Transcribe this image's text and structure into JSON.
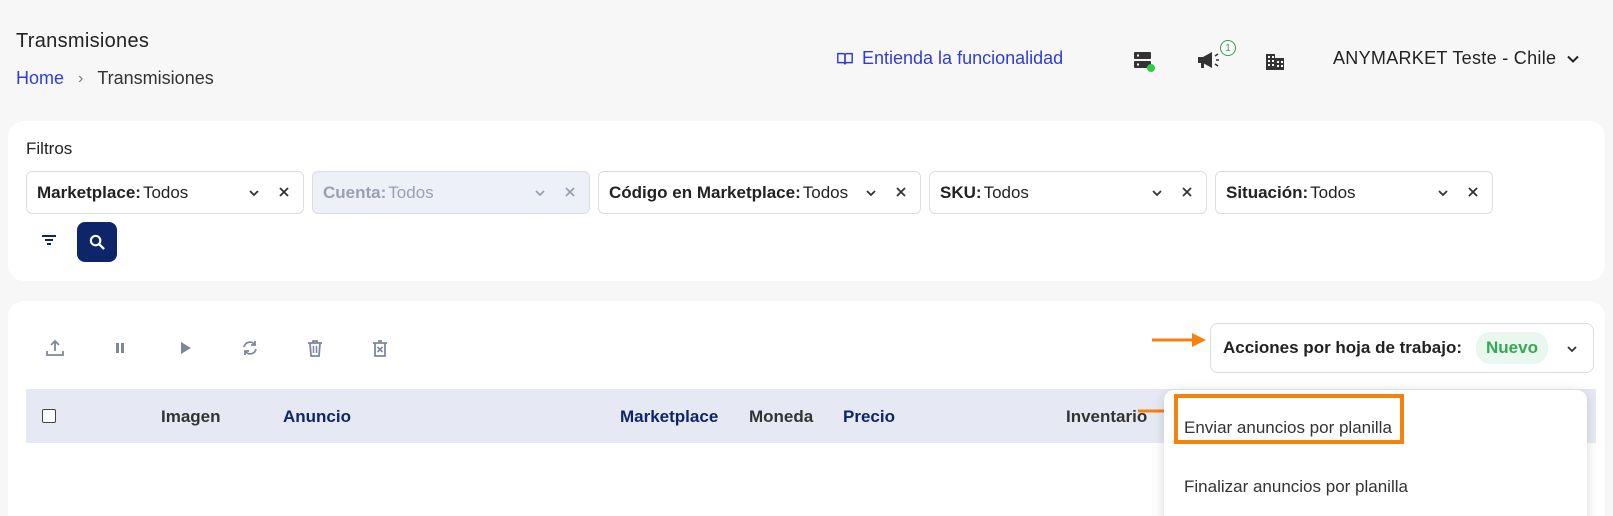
{
  "header": {
    "title": "Transmisiones",
    "breadcrumb": {
      "home": "Home",
      "current": "Transmisiones"
    },
    "learn_link": "Entienda la funcionalidad",
    "notification_count": "1",
    "account": "ANYMARKET Teste - Chile"
  },
  "filters": {
    "label": "Filtros",
    "items": [
      {
        "label": "Marketplace:",
        "value": "Todos"
      },
      {
        "label": "Cuenta:",
        "value": "Todos"
      },
      {
        "label": "Código en Marketplace:",
        "value": "Todos"
      },
      {
        "label": "SKU:",
        "value": "Todos"
      },
      {
        "label": "Situación:",
        "value": "Todos"
      }
    ]
  },
  "actions": {
    "label": "Acciones por hoja de trabajo:",
    "badge": "Nuevo",
    "menu": [
      "Enviar anuncios por planilla",
      "Finalizar anuncios por planilla"
    ]
  },
  "table": {
    "columns": [
      "Imagen",
      "Anuncio",
      "Marketplace",
      "Moneda",
      "Precio",
      "Inventario"
    ]
  },
  "colors": {
    "accent": "#2f3cdc",
    "primary": "#0e2569",
    "highlight": "#f5820f",
    "success": "#34a853"
  }
}
